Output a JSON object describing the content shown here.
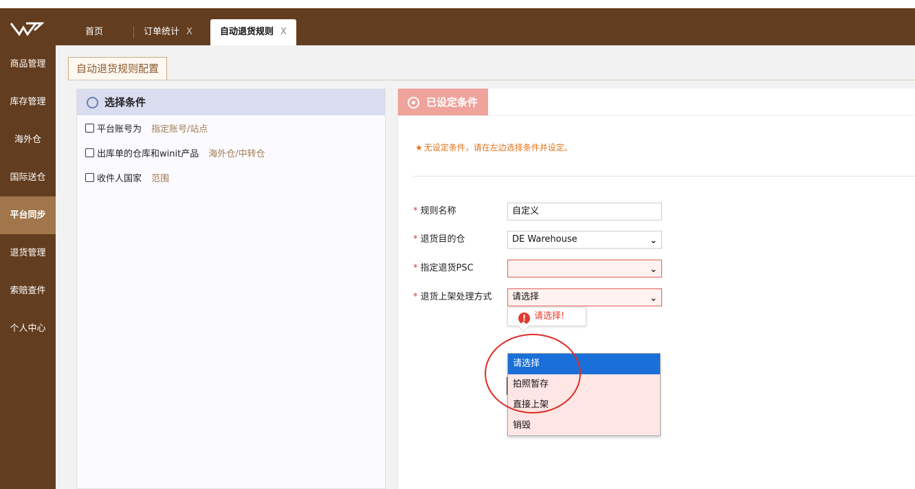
{
  "tabs": [
    {
      "label": "首页",
      "closable": false,
      "active": false
    },
    {
      "label": "订单统计",
      "close": "X",
      "active": false
    },
    {
      "label": "自动退货规则",
      "close": "X",
      "active": true
    }
  ],
  "sidebar": {
    "items": [
      {
        "label": "商品管理"
      },
      {
        "label": "库存管理"
      },
      {
        "label": "海外仓"
      },
      {
        "label": "国际送仓"
      },
      {
        "label": "平台同步",
        "active": true
      },
      {
        "label": "退货管理"
      },
      {
        "label": "索赔查件"
      },
      {
        "label": "个人中心"
      }
    ]
  },
  "page": {
    "tab_title": "自动退货规则配置"
  },
  "conditions_panel": {
    "title": "选择条件",
    "items": [
      {
        "label": "平台账号为",
        "hint": "指定账号/站点",
        "checked": false
      },
      {
        "label": "出库单的仓库和winit产品",
        "hint": "海外仓/中转仓",
        "checked": false
      },
      {
        "label": "收件人国家",
        "hint": "范围",
        "checked": false
      }
    ]
  },
  "set_panel": {
    "title": "已设定条件",
    "notice": "无设定条件，请在左边选择条件并设定。"
  },
  "form": {
    "rule_name": {
      "label": "规则名称",
      "value": "自定义"
    },
    "return_warehouse": {
      "label": "退货目的仓",
      "value": "DE Warehouse"
    },
    "return_psc": {
      "label": "指定退货PSC",
      "value": ""
    },
    "shelf_method": {
      "label": "退货上架处理方式",
      "value": "请选择"
    }
  },
  "tooltip": {
    "text": "请选择!"
  },
  "dropdown": {
    "options": [
      "请选择",
      "拍照暂存",
      "直接上架",
      "销毁"
    ],
    "selected_index": 0
  },
  "colors": {
    "sidebar_bg": "#633d1f",
    "sidebar_active": "#a0764a",
    "accent_red": "#e03b2f",
    "set_header": "#efa39b",
    "select_blue": "#1a6fd8"
  }
}
